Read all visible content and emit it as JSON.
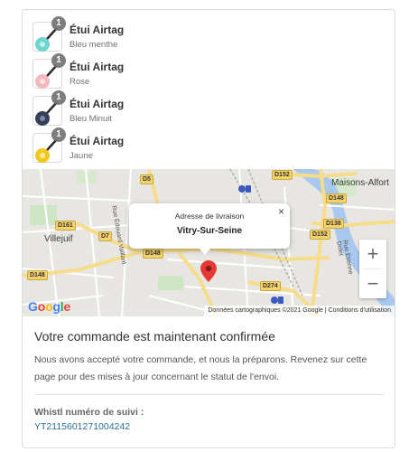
{
  "items": [
    {
      "name": "Étui Airtag",
      "variant": "Bleu menthe",
      "quantity": "1",
      "color": "#6fd6cf",
      "icon": "airtag-case-mint-icon"
    },
    {
      "name": "Étui Airtag",
      "variant": "Rose",
      "quantity": "1",
      "color": "#f2b9bf",
      "icon": "airtag-case-pink-icon"
    },
    {
      "name": "Étui Airtag",
      "variant": "Bleu Minuit",
      "quantity": "1",
      "color": "#33415c",
      "icon": "airtag-case-midnight-icon"
    },
    {
      "name": "Étui Airtag",
      "variant": "Jaune",
      "quantity": "1",
      "color": "#f3c81c",
      "icon": "airtag-case-yellow-icon"
    }
  ],
  "map": {
    "popup_title": "Adresse de livraison",
    "popup_city": "Vitry-Sur-Seine",
    "close_symbol": "×",
    "zoom_in": "+",
    "zoom_out": "−",
    "attribution_data": "Données cartographiques ©2021 Google",
    "attribution_terms": "Conditions d'utilisation",
    "logo_text": "Google",
    "places": {
      "villejuif": "Villejuif",
      "maisons_alfort": "Maisons-Alfort"
    },
    "roads": [
      "D5",
      "D152",
      "D148",
      "D161",
      "D7",
      "D148",
      "D148",
      "D138",
      "D152",
      "D274"
    ],
    "streets": [
      "Rue Édouard Vaillant",
      "Rue Étienne Dolet"
    ],
    "pin_color": "#e53935"
  },
  "confirmation": {
    "title": "Votre commande est maintenant confirmée",
    "message": "Nous avons accepté votre commande, et nous la préparons. Revenez sur cette page pour des mises à jour concernant le statut de l'envoi.",
    "tracking_label": "Whistl numéro de suivi :",
    "tracking_number": "YT2115601271004242"
  }
}
